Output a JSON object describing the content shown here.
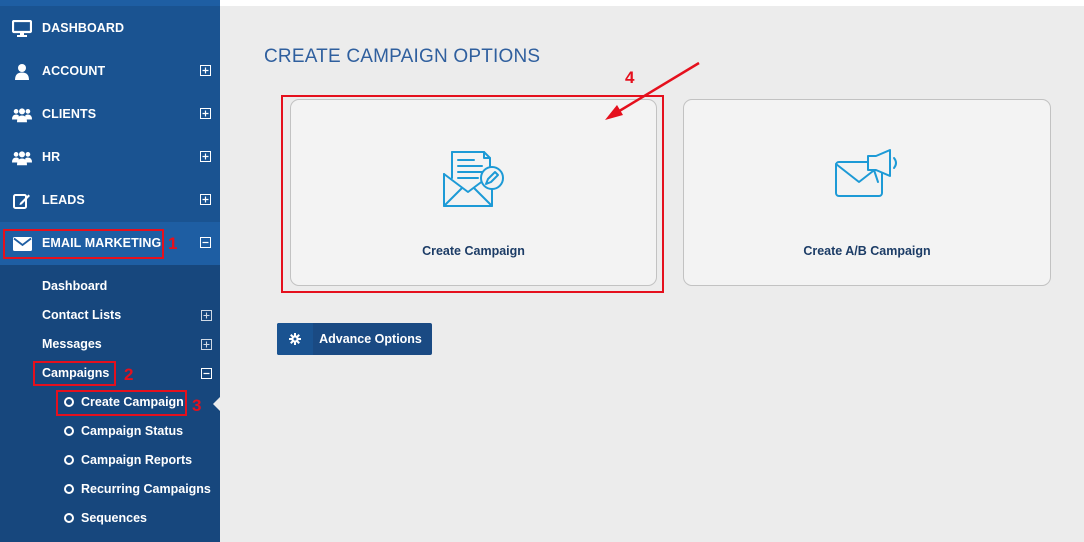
{
  "sidebar": {
    "items": [
      {
        "label": "DASHBOARD",
        "icon": "monitor-icon"
      },
      {
        "label": "ACCOUNT",
        "icon": "user-icon"
      },
      {
        "label": "CLIENTS",
        "icon": "users-icon"
      },
      {
        "label": "HR",
        "icon": "users-icon"
      },
      {
        "label": "LEADS",
        "icon": "edit-icon"
      },
      {
        "label": "EMAIL MARKETING",
        "icon": "envelope-icon"
      }
    ],
    "email_marketing_submenu": [
      {
        "label": "Dashboard"
      },
      {
        "label": "Contact Lists"
      },
      {
        "label": "Messages"
      },
      {
        "label": "Campaigns"
      }
    ],
    "campaigns_submenu": [
      {
        "label": "Create Campaign"
      },
      {
        "label": "Campaign Status"
      },
      {
        "label": "Campaign Reports"
      },
      {
        "label": "Recurring Campaigns"
      },
      {
        "label": "Sequences"
      }
    ]
  },
  "main": {
    "title": "CREATE CAMPAIGN OPTIONS",
    "cards": [
      {
        "label": "Create Campaign",
        "icon": "email-campaign-icon"
      },
      {
        "label": "Create A/B Campaign",
        "icon": "email-megaphone-icon"
      }
    ],
    "advance_button": {
      "label": "Advance Options",
      "icon": "gear-icon"
    }
  },
  "annotations": [
    "1",
    "2",
    "3",
    "4"
  ],
  "colors": {
    "sidebar": "#1a5391",
    "accent": "#e5101d",
    "icon": "#1d9ad6"
  }
}
